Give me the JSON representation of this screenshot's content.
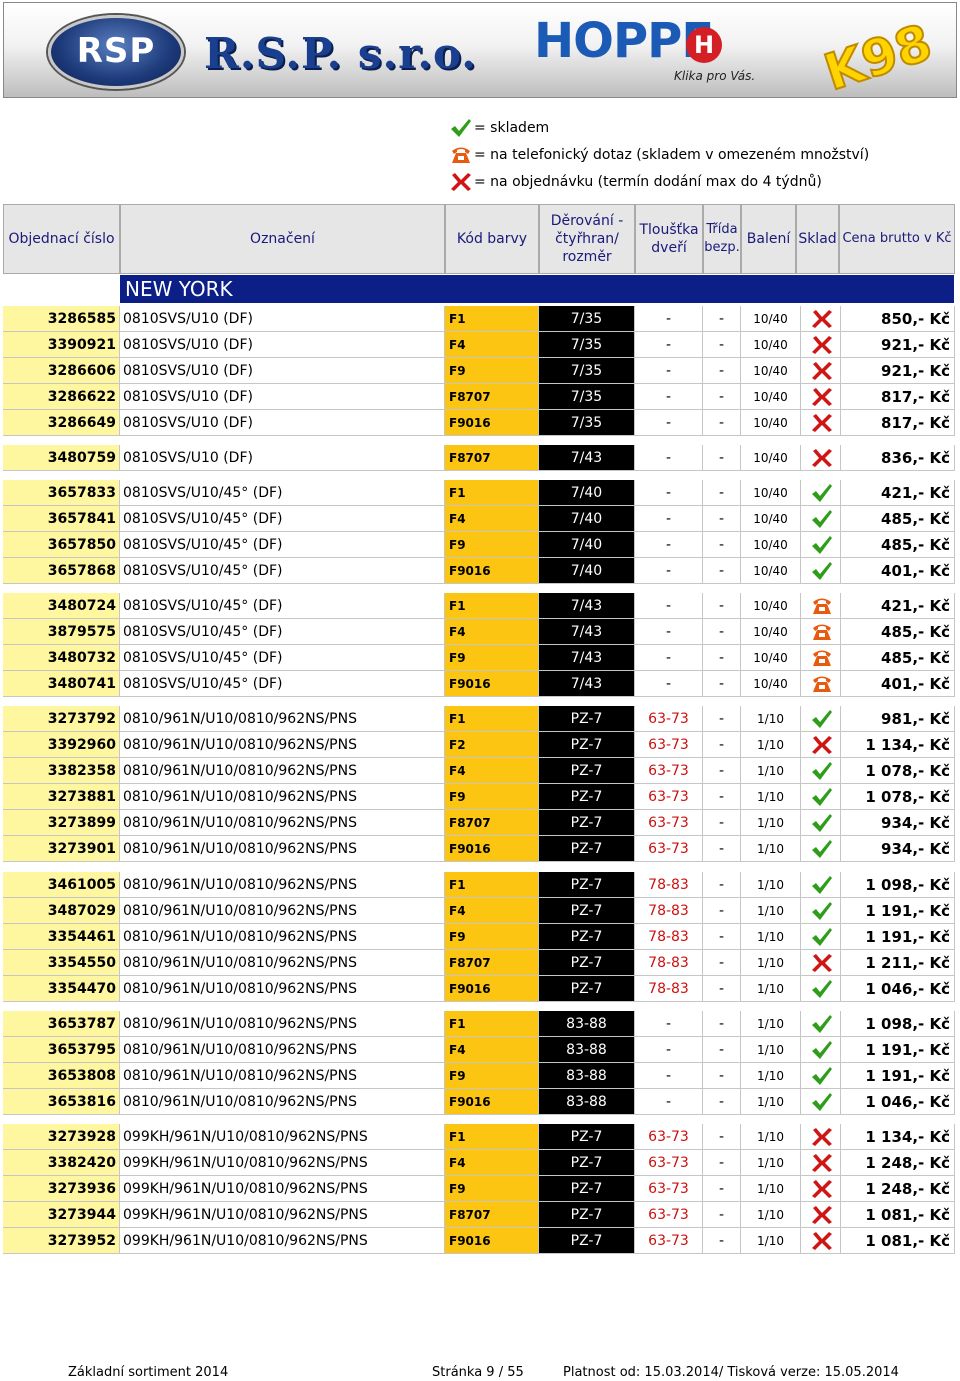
{
  "logos": {
    "rsp_emblem": "RSP",
    "rsp_name": "R.S.P. s.r.o.",
    "hoppe_word": "HOPPE",
    "hoppe_h": "H",
    "hoppe_tagline": "Klika pro Vás.",
    "k98": "K98"
  },
  "legend": [
    {
      "icon": "check-icon",
      "text": "= skladem"
    },
    {
      "icon": "phone-icon",
      "text": "= na telefonický dotaz (skladem v omezeném množství)"
    },
    {
      "icon": "cross-icon",
      "text": "= na objednávku (termín dodání max do 4 týdnů)"
    }
  ],
  "header": {
    "order_no": "Objednací číslo",
    "designation": "Označení",
    "color_code": "Kód barvy",
    "punching": "Děrování - čtyřhran/ rozměr",
    "door_thickness": "Tloušťka dveří",
    "security_class": "Třída bezp.",
    "packaging": "Balení",
    "stock": "Sklad",
    "price": "Cena brutto v Kč"
  },
  "series_title": "NEW YORK",
  "groups": [
    {
      "rows": [
        {
          "no": "3286585",
          "name": "0810SVS/U10 (DF)",
          "color": "F1",
          "dim": "7/35",
          "thick": "-",
          "cls": "-",
          "pack": "10/40",
          "stock": "cross",
          "price": "850,- Kč"
        },
        {
          "no": "3390921",
          "name": "0810SVS/U10 (DF)",
          "color": "F4",
          "dim": "7/35",
          "thick": "-",
          "cls": "-",
          "pack": "10/40",
          "stock": "cross",
          "price": "921,- Kč"
        },
        {
          "no": "3286606",
          "name": "0810SVS/U10 (DF)",
          "color": "F9",
          "dim": "7/35",
          "thick": "-",
          "cls": "-",
          "pack": "10/40",
          "stock": "cross",
          "price": "921,- Kč"
        },
        {
          "no": "3286622",
          "name": "0810SVS/U10 (DF)",
          "color": "F8707",
          "dim": "7/35",
          "thick": "-",
          "cls": "-",
          "pack": "10/40",
          "stock": "cross",
          "price": "817,- Kč"
        },
        {
          "no": "3286649",
          "name": "0810SVS/U10 (DF)",
          "color": "F9016",
          "dim": "7/35",
          "thick": "-",
          "cls": "-",
          "pack": "10/40",
          "stock": "cross",
          "price": "817,- Kč"
        }
      ]
    },
    {
      "rows": [
        {
          "no": "3480759",
          "name": "0810SVS/U10 (DF)",
          "color": "F8707",
          "dim": "7/43",
          "thick": "-",
          "cls": "-",
          "pack": "10/40",
          "stock": "cross",
          "price": "836,- Kč"
        }
      ]
    },
    {
      "rows": [
        {
          "no": "3657833",
          "name": "0810SVS/U10/45° (DF)",
          "color": "F1",
          "dim": "7/40",
          "thick": "-",
          "cls": "-",
          "pack": "10/40",
          "stock": "check",
          "price": "421,- Kč"
        },
        {
          "no": "3657841",
          "name": "0810SVS/U10/45° (DF)",
          "color": "F4",
          "dim": "7/40",
          "thick": "-",
          "cls": "-",
          "pack": "10/40",
          "stock": "check",
          "price": "485,- Kč"
        },
        {
          "no": "3657850",
          "name": "0810SVS/U10/45° (DF)",
          "color": "F9",
          "dim": "7/40",
          "thick": "-",
          "cls": "-",
          "pack": "10/40",
          "stock": "check",
          "price": "485,- Kč"
        },
        {
          "no": "3657868",
          "name": "0810SVS/U10/45° (DF)",
          "color": "F9016",
          "dim": "7/40",
          "thick": "-",
          "cls": "-",
          "pack": "10/40",
          "stock": "check",
          "price": "401,- Kč"
        }
      ]
    },
    {
      "rows": [
        {
          "no": "3480724",
          "name": "0810SVS/U10/45° (DF)",
          "color": "F1",
          "dim": "7/43",
          "thick": "-",
          "cls": "-",
          "pack": "10/40",
          "stock": "phone",
          "price": "421,- Kč"
        },
        {
          "no": "3879575",
          "name": "0810SVS/U10/45° (DF)",
          "color": "F4",
          "dim": "7/43",
          "thick": "-",
          "cls": "-",
          "pack": "10/40",
          "stock": "phone",
          "price": "485,- Kč"
        },
        {
          "no": "3480732",
          "name": "0810SVS/U10/45° (DF)",
          "color": "F9",
          "dim": "7/43",
          "thick": "-",
          "cls": "-",
          "pack": "10/40",
          "stock": "phone",
          "price": "485,- Kč"
        },
        {
          "no": "3480741",
          "name": "0810SVS/U10/45° (DF)",
          "color": "F9016",
          "dim": "7/43",
          "thick": "-",
          "cls": "-",
          "pack": "10/40",
          "stock": "phone",
          "price": "401,- Kč"
        }
      ]
    },
    {
      "rows": [
        {
          "no": "3273792",
          "name": "0810/961N/U10/0810/962NS/PNS",
          "color": "F1",
          "dim": "PZ-7",
          "thick": "63-73",
          "cls": "-",
          "pack": "1/10",
          "stock": "check",
          "price": "981,- Kč"
        },
        {
          "no": "3392960",
          "name": "0810/961N/U10/0810/962NS/PNS",
          "color": "F2",
          "dim": "PZ-7",
          "thick": "63-73",
          "cls": "-",
          "pack": "1/10",
          "stock": "cross",
          "price": "1 134,- Kč"
        },
        {
          "no": "3382358",
          "name": "0810/961N/U10/0810/962NS/PNS",
          "color": "F4",
          "dim": "PZ-7",
          "thick": "63-73",
          "cls": "-",
          "pack": "1/10",
          "stock": "check",
          "price": "1 078,- Kč"
        },
        {
          "no": "3273881",
          "name": "0810/961N/U10/0810/962NS/PNS",
          "color": "F9",
          "dim": "PZ-7",
          "thick": "63-73",
          "cls": "-",
          "pack": "1/10",
          "stock": "check",
          "price": "1 078,- Kč"
        },
        {
          "no": "3273899",
          "name": "0810/961N/U10/0810/962NS/PNS",
          "color": "F8707",
          "dim": "PZ-7",
          "thick": "63-73",
          "cls": "-",
          "pack": "1/10",
          "stock": "check",
          "price": "934,- Kč"
        },
        {
          "no": "3273901",
          "name": "0810/961N/U10/0810/962NS/PNS",
          "color": "F9016",
          "dim": "PZ-7",
          "thick": "63-73",
          "cls": "-",
          "pack": "1/10",
          "stock": "check",
          "price": "934,- Kč"
        }
      ]
    },
    {
      "rows": [
        {
          "no": "3461005",
          "name": "0810/961N/U10/0810/962NS/PNS",
          "color": "F1",
          "dim": "PZ-7",
          "thick": "78-83",
          "cls": "-",
          "pack": "1/10",
          "stock": "check",
          "price": "1 098,- Kč"
        },
        {
          "no": "3487029",
          "name": "0810/961N/U10/0810/962NS/PNS",
          "color": "F4",
          "dim": "PZ-7",
          "thick": "78-83",
          "cls": "-",
          "pack": "1/10",
          "stock": "check",
          "price": "1 191,- Kč"
        },
        {
          "no": "3354461",
          "name": "0810/961N/U10/0810/962NS/PNS",
          "color": "F9",
          "dim": "PZ-7",
          "thick": "78-83",
          "cls": "-",
          "pack": "1/10",
          "stock": "check",
          "price": "1 191,- Kč"
        },
        {
          "no": "3354550",
          "name": "0810/961N/U10/0810/962NS/PNS",
          "color": "F8707",
          "dim": "PZ-7",
          "thick": "78-83",
          "cls": "-",
          "pack": "1/10",
          "stock": "cross",
          "price": "1 211,- Kč"
        },
        {
          "no": "3354470",
          "name": "0810/961N/U10/0810/962NS/PNS",
          "color": "F9016",
          "dim": "PZ-7",
          "thick": "78-83",
          "cls": "-",
          "pack": "1/10",
          "stock": "check",
          "price": "1 046,- Kč"
        }
      ]
    },
    {
      "rows": [
        {
          "no": "3653787",
          "name": "0810/961N/U10/0810/962NS/PNS",
          "color": "F1",
          "dim": "83-88",
          "thick": "-",
          "cls": "-",
          "pack": "1/10",
          "stock": "check",
          "price": "1 098,- Kč"
        },
        {
          "no": "3653795",
          "name": "0810/961N/U10/0810/962NS/PNS",
          "color": "F4",
          "dim": "83-88",
          "thick": "-",
          "cls": "-",
          "pack": "1/10",
          "stock": "check",
          "price": "1 191,- Kč"
        },
        {
          "no": "3653808",
          "name": "0810/961N/U10/0810/962NS/PNS",
          "color": "F9",
          "dim": "83-88",
          "thick": "-",
          "cls": "-",
          "pack": "1/10",
          "stock": "check",
          "price": "1 191,- Kč"
        },
        {
          "no": "3653816",
          "name": "0810/961N/U10/0810/962NS/PNS",
          "color": "F9016",
          "dim": "83-88",
          "thick": "-",
          "cls": "-",
          "pack": "1/10",
          "stock": "check",
          "price": "1 046,- Kč"
        }
      ]
    },
    {
      "rows": [
        {
          "no": "3273928",
          "name": "099KH/961N/U10/0810/962NS/PNS",
          "color": "F1",
          "dim": "PZ-7",
          "thick": "63-73",
          "cls": "-",
          "pack": "1/10",
          "stock": "cross",
          "price": "1 134,- Kč"
        },
        {
          "no": "3382420",
          "name": "099KH/961N/U10/0810/962NS/PNS",
          "color": "F4",
          "dim": "PZ-7",
          "thick": "63-73",
          "cls": "-",
          "pack": "1/10",
          "stock": "cross",
          "price": "1 248,- Kč"
        },
        {
          "no": "3273936",
          "name": "099KH/961N/U10/0810/962NS/PNS",
          "color": "F9",
          "dim": "PZ-7",
          "thick": "63-73",
          "cls": "-",
          "pack": "1/10",
          "stock": "cross",
          "price": "1 248,- Kč"
        },
        {
          "no": "3273944",
          "name": "099KH/961N/U10/0810/962NS/PNS",
          "color": "F8707",
          "dim": "PZ-7",
          "thick": "63-73",
          "cls": "-",
          "pack": "1/10",
          "stock": "cross",
          "price": "1 081,- Kč"
        },
        {
          "no": "3273952",
          "name": "099KH/961N/U10/0810/962NS/PNS",
          "color": "F9016",
          "dim": "PZ-7",
          "thick": "63-73",
          "cls": "-",
          "pack": "1/10",
          "stock": "cross",
          "price": "1 081,- Kč"
        }
      ]
    }
  ],
  "footer": {
    "left": "Základní sortiment 2014",
    "page": "Stránka 9 / 55",
    "validity": "Platnost od: 15.03.2014/ Tisková verze: 15.05.2014"
  },
  "colors": {
    "header_bg": "#e6e6e6",
    "series_bar": "#0b1f86",
    "order_no_bg": "#fff79f",
    "color_code_bg": "#fbc512",
    "dimension_bg": "#000000",
    "check": "#2e9e1a",
    "cross": "#d01515",
    "phone": "#e85a10",
    "thickness_range": "#cc1111"
  }
}
